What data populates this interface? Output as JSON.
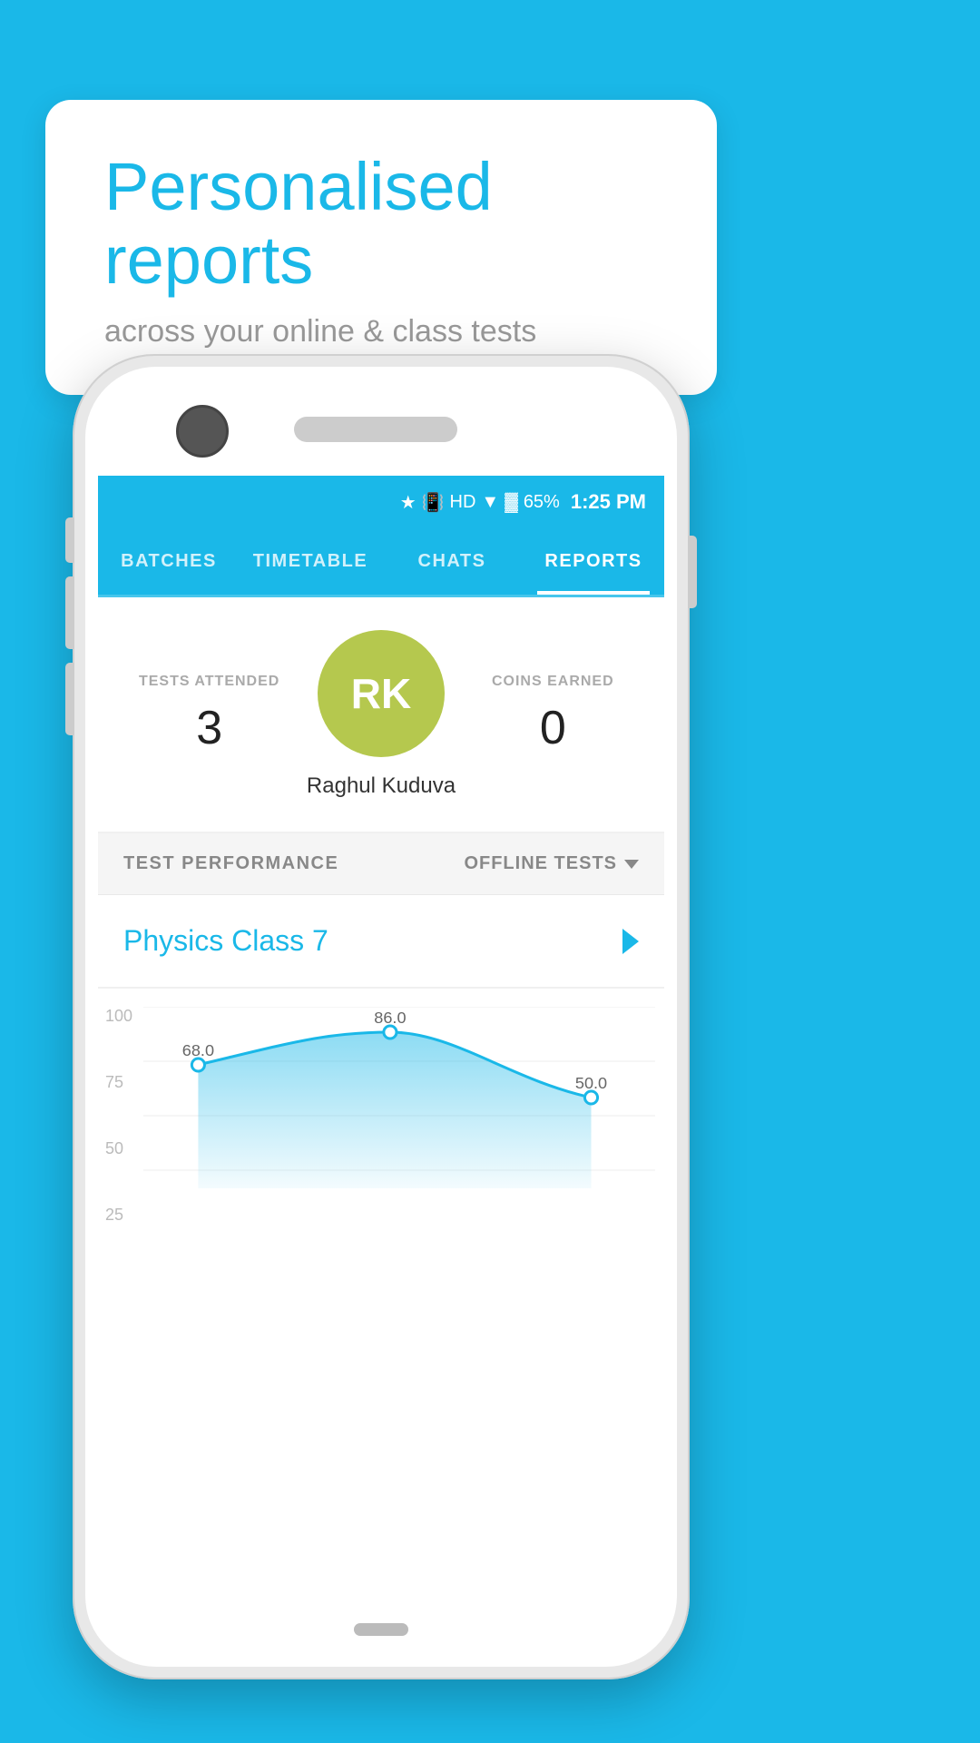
{
  "background_color": "#1ab8e8",
  "tooltip": {
    "title": "Personalised reports",
    "subtitle": "across your online & class tests"
  },
  "status_bar": {
    "battery_percent": "65%",
    "time": "1:25 PM",
    "icons": "bluetooth vibrate hd wifi signal cross 65%"
  },
  "nav": {
    "tabs": [
      {
        "label": "BATCHES",
        "active": false
      },
      {
        "label": "TIMETABLE",
        "active": false
      },
      {
        "label": "CHATS",
        "active": false
      },
      {
        "label": "REPORTS",
        "active": true
      }
    ]
  },
  "profile": {
    "tests_attended_label": "TESTS ATTENDED",
    "tests_attended_value": "3",
    "avatar_initials": "RK",
    "avatar_name": "Raghul Kuduva",
    "coins_earned_label": "COINS EARNED",
    "coins_earned_value": "0"
  },
  "performance": {
    "section_label": "TEST PERFORMANCE",
    "filter_label": "OFFLINE TESTS",
    "class_name": "Physics Class 7",
    "chart": {
      "y_labels": [
        "100",
        "75",
        "50",
        "25"
      ],
      "data_points": [
        {
          "label": "68.0",
          "value": 68
        },
        {
          "label": "86.0",
          "value": 86
        },
        {
          "label": "50.0",
          "value": 50
        }
      ]
    }
  }
}
